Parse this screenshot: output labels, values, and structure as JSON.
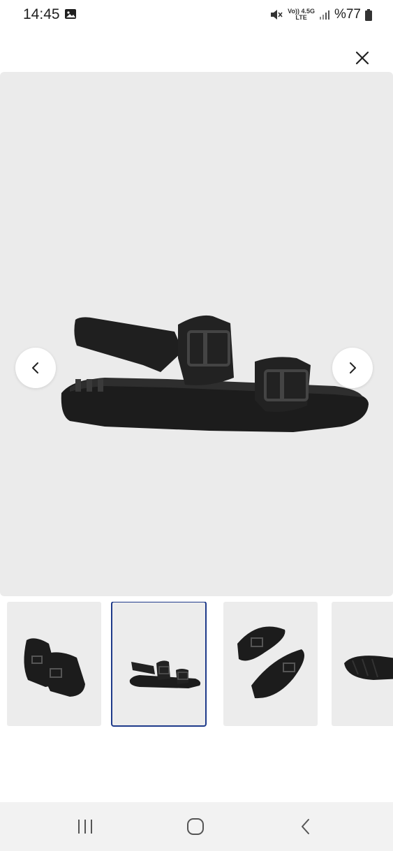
{
  "status": {
    "time": "14:45",
    "network_top": "Vo)) 4.5G",
    "network_bottom": "LTE",
    "battery": "%77"
  },
  "colors": {
    "hero_background": "#ebebeb",
    "active_thumb_border": "#1e3a8a",
    "product": "#1c1c1c"
  },
  "icons": {
    "close": "close-icon",
    "prev": "chevron-left-icon",
    "next": "chevron-right-icon"
  },
  "gallery": {
    "thumbnail_count": 4,
    "active_index": 2
  }
}
